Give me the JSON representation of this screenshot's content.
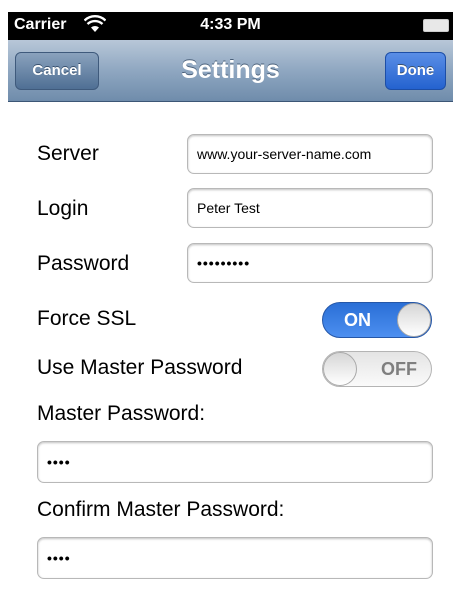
{
  "status_bar": {
    "carrier": "Carrier",
    "time": "4:33 PM"
  },
  "nav": {
    "title": "Settings",
    "cancel_label": "Cancel",
    "done_label": "Done"
  },
  "form": {
    "server_label": "Server",
    "server_value": "www.your-server-name.com",
    "login_label": "Login",
    "login_value": "Peter Test",
    "password_label": "Password",
    "password_value": "•••••••••",
    "force_ssl_label": "Force SSL",
    "force_ssl_state": "ON",
    "use_master_label": "Use Master Password",
    "use_master_state": "OFF",
    "master_label": "Master Password:",
    "master_value": "••••",
    "confirm_label": "Confirm Master Password:",
    "confirm_value": "••••"
  },
  "colors": {
    "switch_on": "#2a6fd6",
    "done_button": "#2462cf",
    "nav_bar": "#8fa7c1"
  }
}
